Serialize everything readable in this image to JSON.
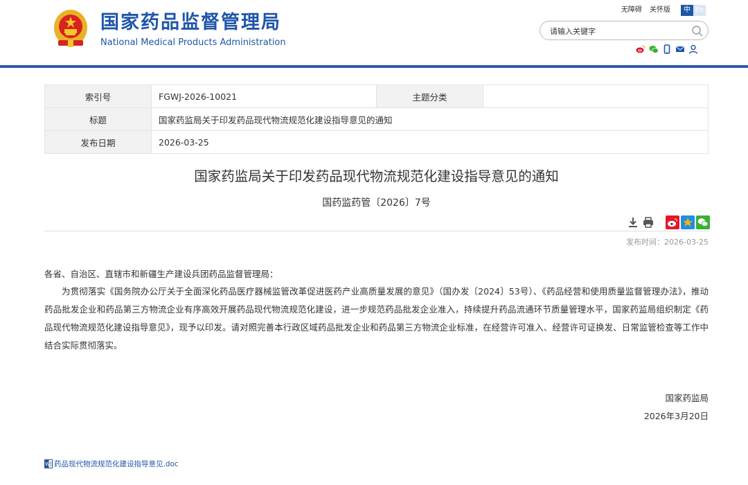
{
  "header": {
    "site_name_cn": "国家药品监督管理局",
    "site_name_en": "National Medical Products Administration",
    "top_links": [
      "无障碍",
      "关怀版"
    ],
    "lang": {
      "zh": "中",
      "en": "En"
    },
    "search_placeholder": "请输入关键字",
    "social_icons": [
      "weibo-icon",
      "wechat-icon",
      "mobile-icon",
      "mail-icon",
      "user-icon"
    ]
  },
  "meta": {
    "index_label": "索引号",
    "index_value": "FGWJ-2026-10021",
    "category_label": "主题分类",
    "category_value": "",
    "title_label": "标题",
    "title_value": "国家药监局关于印发药品现代物流规范化建设指导意见的通知",
    "date_label": "发布日期",
    "date_value": "2026-03-25"
  },
  "article": {
    "title": "国家药监局关于印发药品现代物流规范化建设指导意见的通知",
    "doc_number": "国药监药管〔2026〕7号",
    "publish_time": "发布时间：2026-03-25",
    "salutation": "各省、自治区、直辖市和新疆生产建设兵团药品监督管理局：",
    "body": "为贯彻落实《国务院办公厅关于全面深化药品医疗器械监管改革促进医药产业高质量发展的意见》（国办发〔2024〕53号）、《药品经营和使用质量监督管理办法》，推动药品批发企业和药品第三方物流企业有序高效开展药品现代物流规范化建设，进一步规范药品批发企业准入，持续提升药品流通环节质量管理水平，国家药监局组织制定《药品现代物流规范化建设指导意见》，现予以印发。请对照完善本行政区域药品批发企业和药品第三方物流企业标准，在经营许可准入、经营许可证换发、日常监管检查等工作中结合实际贯彻落实。",
    "sign_org": "国家药监局",
    "sign_date": "2026年3月20日",
    "attachment": "药品现代物流规范化建设指导意见.doc"
  },
  "colors": {
    "brand_blue": "#1f56a8",
    "header_bar": "#2c5aa8",
    "weibo": "#e6162d",
    "qzone": "#f5b400",
    "wechat": "#3cb034"
  }
}
